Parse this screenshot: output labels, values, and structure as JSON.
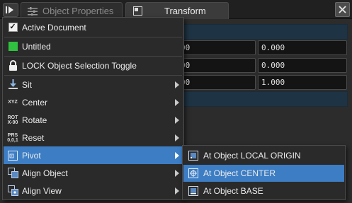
{
  "tabs": {
    "pin_icon": "collapse-panel-icon",
    "object_properties": "Object Properties",
    "transform": "Transform",
    "close_icon": "close-icon"
  },
  "fields": [
    [
      "00",
      "0.000"
    ],
    [
      "00",
      "0.000"
    ],
    [
      "00",
      "1.000"
    ]
  ],
  "menu": {
    "items": [
      {
        "label": "Active Document",
        "icon": "checkbox-checked-icon",
        "checked": true
      },
      {
        "label": "Untitled",
        "icon": "green-swatch-icon",
        "color": "#2fc13f"
      },
      {
        "label": "LOCK Object Selection Toggle",
        "icon": "lock-icon"
      },
      {
        "label": "Sit",
        "icon": "sit-icon",
        "submenu": true
      },
      {
        "label": "Center",
        "icon": "xyz-center-icon",
        "icon_text": [
          "XYZ"
        ],
        "submenu": true
      },
      {
        "label": "Rotate",
        "icon": "rotate-icon",
        "icon_text": [
          "ROT",
          "X-90"
        ],
        "submenu": true
      },
      {
        "label": "Reset",
        "icon": "reset-icon",
        "icon_text": [
          "PRS",
          "0,0,1"
        ],
        "submenu": true
      },
      {
        "label": "Pivot",
        "icon": "pivot-icon",
        "submenu": true,
        "active": true
      },
      {
        "label": "Align Object",
        "icon": "align-object-icon",
        "submenu": true
      },
      {
        "label": "Align View",
        "icon": "align-view-icon",
        "submenu": true
      }
    ]
  },
  "submenu": {
    "items": [
      {
        "label": "At Object LOCAL ORIGIN",
        "icon": "local-origin-icon"
      },
      {
        "label": "At Object CENTER",
        "icon": "object-center-icon",
        "active": true
      },
      {
        "label": "At Object BASE",
        "icon": "object-base-icon"
      }
    ]
  },
  "colors": {
    "highlight": "#3c7dc4",
    "section_bar": "#1e3344",
    "swatch_green": "#2fc13f"
  }
}
